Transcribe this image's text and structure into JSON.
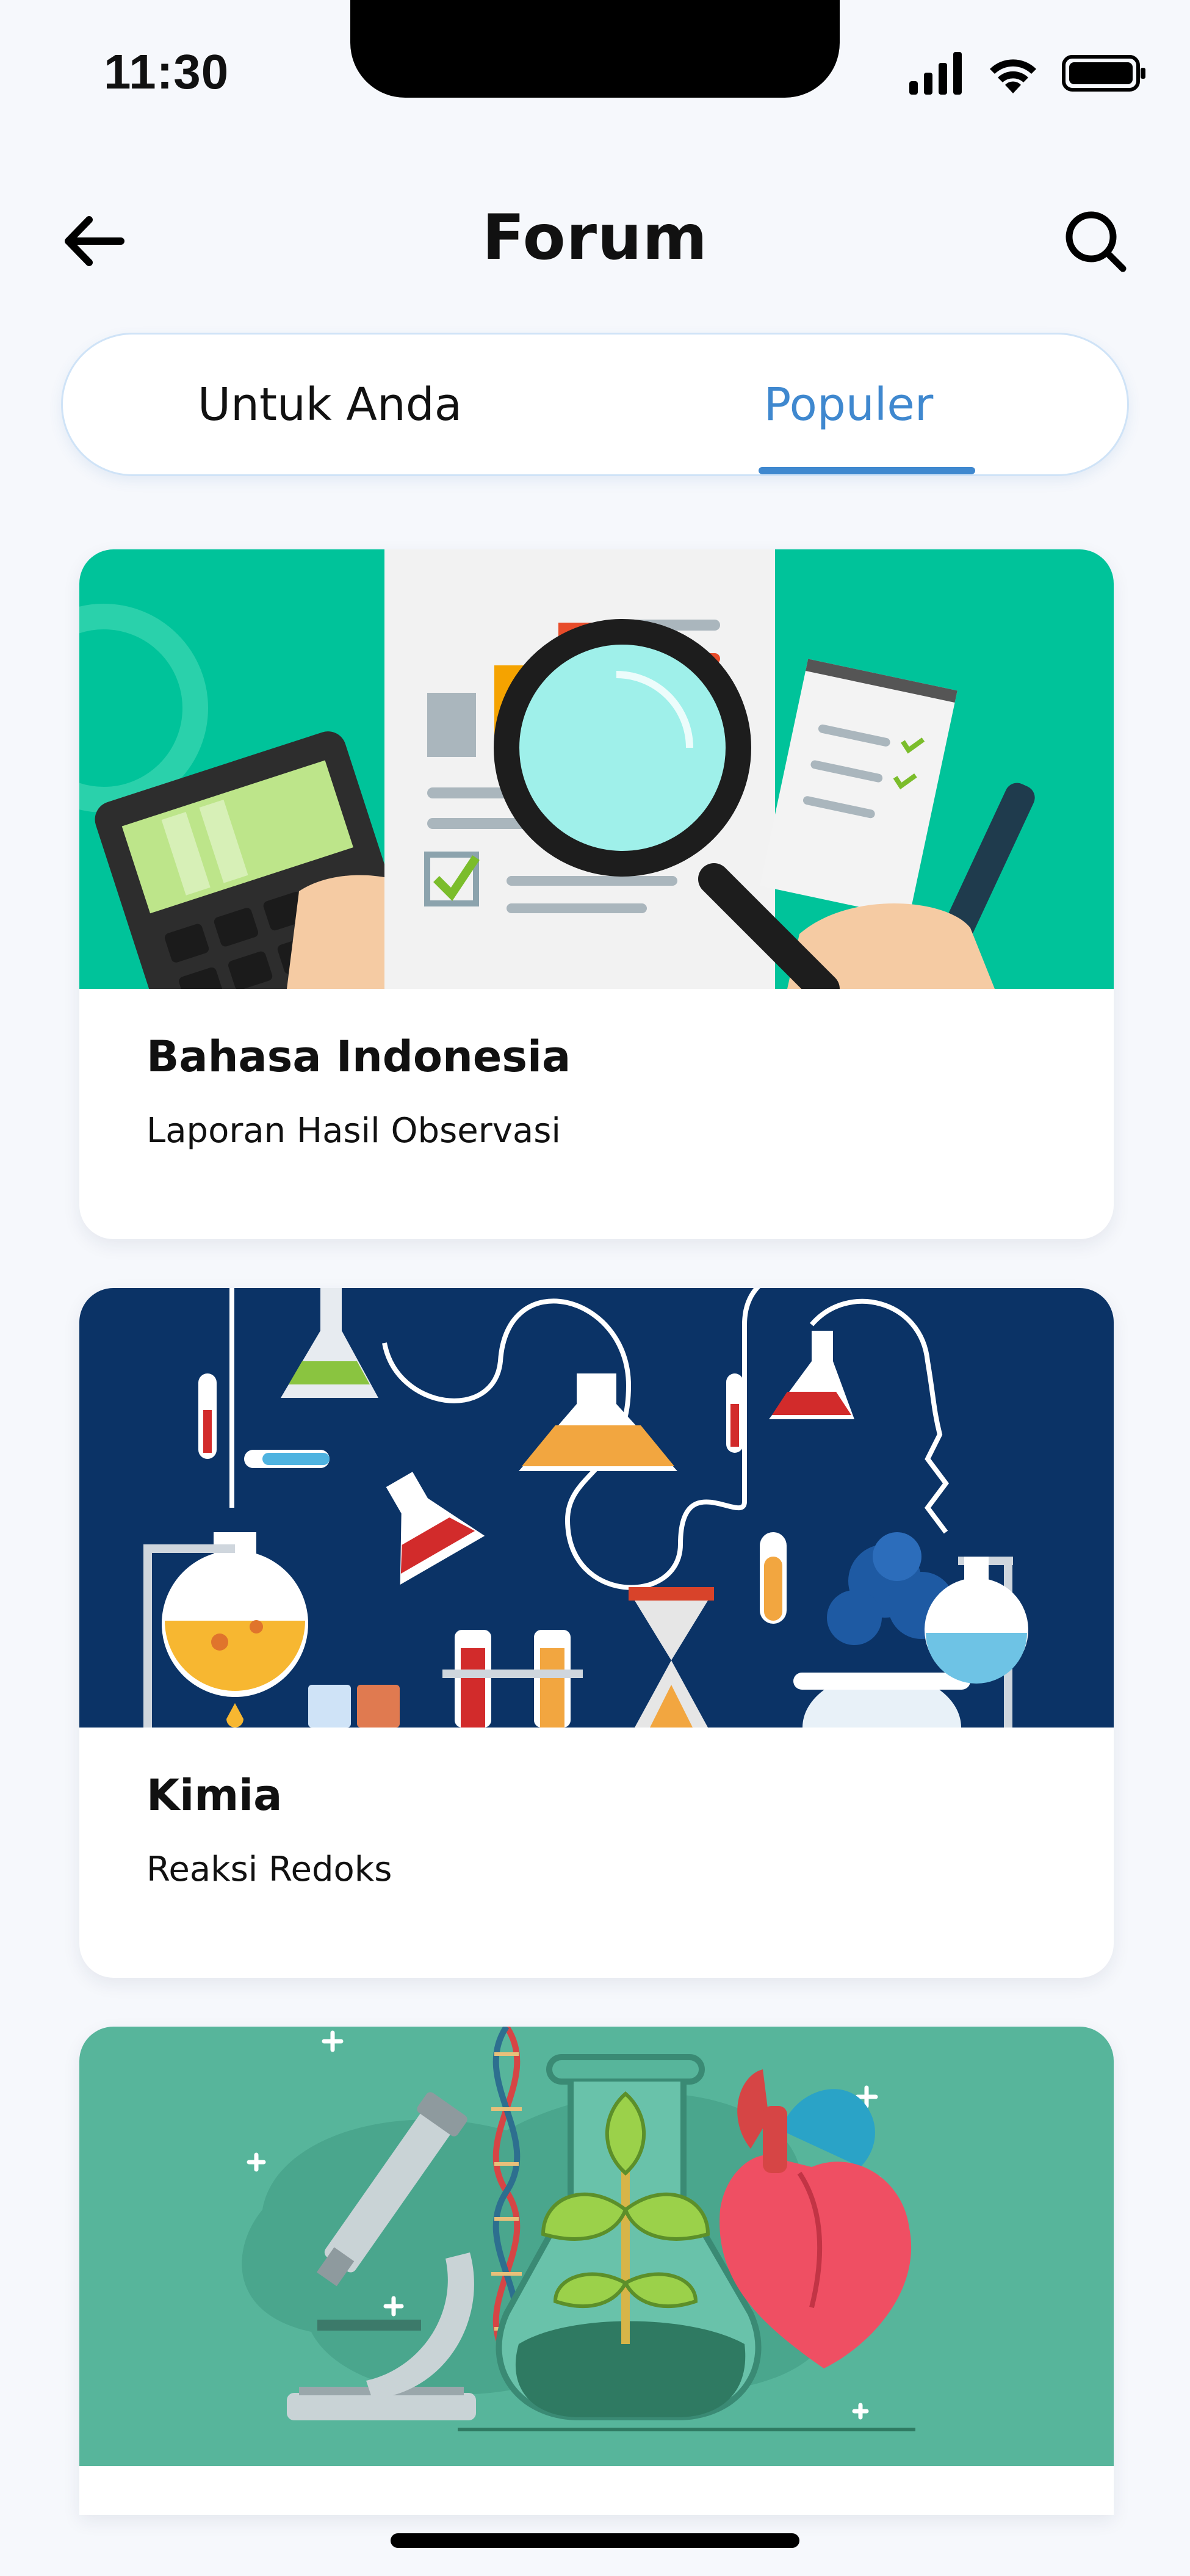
{
  "status_bar": {
    "time": "11:30"
  },
  "header": {
    "title": "Forum",
    "back_icon": "arrow-left-icon",
    "search_icon": "search-icon"
  },
  "tabs": [
    {
      "label": "Untuk Anda",
      "active": false
    },
    {
      "label": "Populer",
      "active": true
    }
  ],
  "colors": {
    "accent": "#3f88cf",
    "background": "#f6f8fc",
    "card_1_banner": "#00c39a",
    "card_2_banner": "#0b3366",
    "card_3_banner": "#57b59b"
  },
  "cards": [
    {
      "title": "Bahasa Indonesia",
      "subtitle": "Laporan Hasil Observasi",
      "image": "document-analysis-illustration"
    },
    {
      "title": "Kimia",
      "subtitle": "Reaksi Redoks",
      "image": "chemistry-lab-illustration"
    },
    {
      "title": "",
      "subtitle": "",
      "image": "biology-science-illustration"
    }
  ]
}
